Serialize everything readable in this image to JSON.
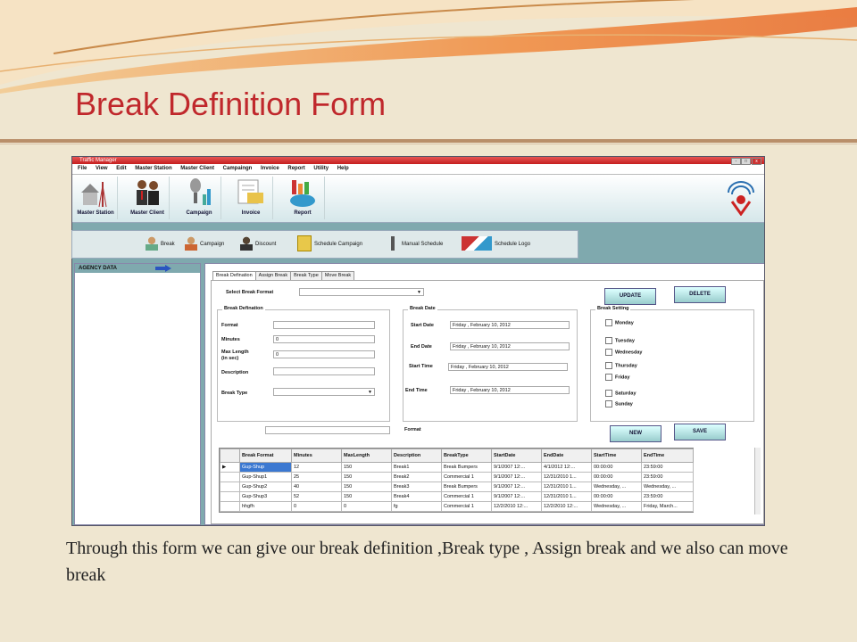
{
  "slide": {
    "title": "Break Definition Form",
    "caption": "Through this form we can give our break definition ,Break type , Assign break and we also can move break"
  },
  "window": {
    "title": "Traffic Manager",
    "controls": [
      "-",
      "□",
      "x"
    ]
  },
  "menu": [
    "File",
    "View",
    "Edit",
    "Master Station",
    "Master Client",
    "Campaingn",
    "Invoice",
    "Report",
    "Utility",
    "Help"
  ],
  "toolbar1": [
    {
      "label": "Master Station",
      "icon": "tower-icon"
    },
    {
      "label": "Master Client",
      "icon": "people-icon"
    },
    {
      "label": "Campaign",
      "icon": "microphone-icon"
    },
    {
      "label": "Invoice",
      "icon": "invoice-icon"
    },
    {
      "label": "Report",
      "icon": "chart-icon"
    }
  ],
  "toolbar2": [
    {
      "label": "Break",
      "icon": "user-add-icon"
    },
    {
      "label": "Campaign",
      "icon": "user-icon"
    },
    {
      "label": "Discount",
      "icon": "person-icon"
    },
    {
      "label": "Schedule Campaign",
      "icon": "folder-icon"
    },
    {
      "label": "Manual Schedule",
      "icon": "mic-icon"
    },
    {
      "label": "Schedule Logo",
      "icon": "logo-icon"
    }
  ],
  "sidebar": {
    "header": "AGENCY DATA"
  },
  "tabs": [
    "Break Defination",
    "Assign Break",
    "Break Type",
    "Move Break"
  ],
  "form": {
    "select_break_format_label": "Select Break Format",
    "update_label": "UPDATE",
    "delete_label": "DELETE",
    "new_label": "NEW",
    "save_label": "SAVE",
    "format_label2": "Format",
    "break_definition": {
      "title": "Break Defination",
      "format_label": "Format",
      "minutes_label": "Minutes",
      "minutes_value": "0",
      "maxlength_label1": "Max Length",
      "maxlength_label2": "(in sec)",
      "maxlength_value": "0",
      "description_label": "Description",
      "breaktype_label": "Break Type"
    },
    "break_date": {
      "title": "Break Date",
      "start_date_label": "Start Date",
      "end_date_label": "End Date",
      "start_time_label": "Start Time",
      "end_time_label": "End Time",
      "start_date": "Friday   ,  February  10, 2012",
      "end_date": "Friday   ,  February  10, 2012",
      "start_time": "Friday   ,  February  10, 2012",
      "end_time": "Friday   ,  February  10, 2012"
    },
    "break_setting": {
      "title": "Break Setting",
      "days": [
        "Monday",
        "Tuesday",
        "Wednesday",
        "Thursday",
        "Friday",
        "Saturday",
        "Sunday"
      ]
    }
  },
  "grid": {
    "headers": [
      "Break Format",
      "Minutes",
      "MaxLength",
      "Description",
      "BreakType",
      "StartDate",
      "EndDate",
      "StartTime",
      "EndTime"
    ],
    "rows": [
      [
        "Gup-Shup",
        "12",
        "150",
        "Break1",
        "Break Bumpers",
        "9/1/2007 12:...",
        "4/1/2012 12:...",
        "00:00:00",
        "23:59:00"
      ],
      [
        "Gup-Shup1",
        "25",
        "150",
        "Break2",
        "Commercial 1",
        "9/1/2007 12:...",
        "12/31/2010 1...",
        "00:00:00",
        "23:59:00"
      ],
      [
        "Gup-Shup2",
        "40",
        "150",
        "Break3",
        "Break Bumpers",
        "9/1/2007 12:...",
        "12/31/2010 1...",
        "Wednesday, ...",
        "Wednesday, ..."
      ],
      [
        "Gup-Shup3",
        "52",
        "150",
        "Break4",
        "Commercial 1",
        "9/1/2007 12:...",
        "12/31/2010 1...",
        "00:00:00",
        "23:59:00"
      ],
      [
        "hhgfh",
        "0",
        "0",
        "fg",
        "Commercial 1",
        "12/2/2010 12:...",
        "12/2/2010 12:...",
        "Wednesday, ...",
        "Friday, March..."
      ]
    ]
  }
}
